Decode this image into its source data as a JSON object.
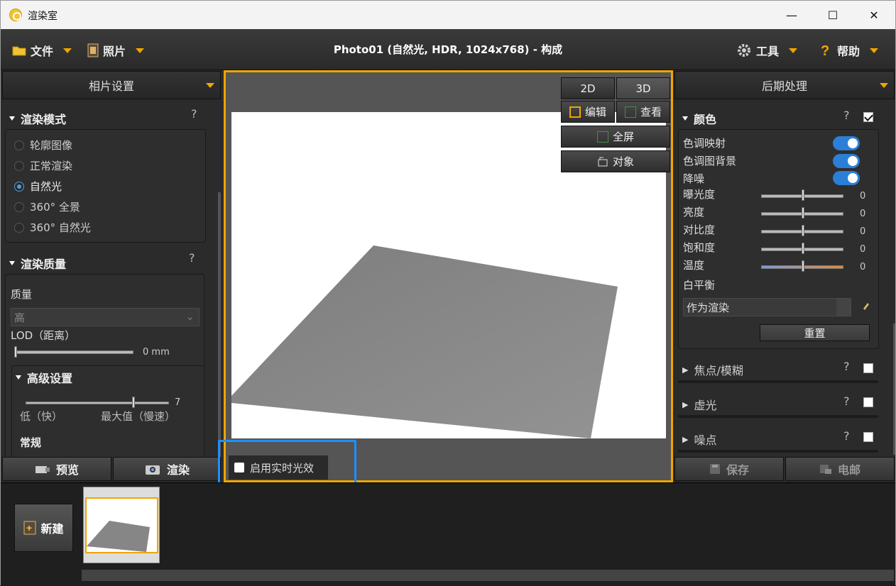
{
  "window": {
    "title": "渲染室",
    "minimize": "—",
    "maximize": "☐",
    "close": "✕"
  },
  "menubar": {
    "file": "文件",
    "photo": "照片",
    "doc_title": "Photo01 (自然光, HDR, 1024x768) - 构成",
    "tools": "工具",
    "help": "帮助"
  },
  "left_panel": {
    "header": "相片设置",
    "render_mode": {
      "title": "渲染模式",
      "help": "?",
      "options": [
        "轮廓图像",
        "正常渲染",
        "自然光",
        "360° 全景",
        "360° 自然光"
      ],
      "selected_index": 2
    },
    "render_quality": {
      "title": "渲染质量",
      "help": "?",
      "quality_label": "质量",
      "quality_value": "高",
      "lod_label": "LOD（距离）",
      "lod_value": "0 mm",
      "lod_slider": 0
    },
    "advanced": {
      "title": "高级设置",
      "slider_value": "7",
      "slider_level": 0.75,
      "low_label": "低（快）",
      "max_label": "最大值（慢速）",
      "general_label": "常规"
    },
    "preview_button": "预览",
    "render_button": "渲染"
  },
  "viewport": {
    "btn_2d": "2D",
    "btn_3d": "3D",
    "btn_edit": "编辑",
    "btn_view": "查看",
    "btn_fullscreen": "全屏",
    "btn_object": "对象",
    "realtime_label": "启用实时光效"
  },
  "right_panel": {
    "header": "后期处理",
    "color": {
      "title": "颜色",
      "help": "?",
      "enabled": true,
      "tone_mapping": "色调映射",
      "tone_bg": "色调图背景",
      "denoise": "降噪",
      "exposure": "曝光度",
      "brightness": "亮度",
      "contrast": "对比度",
      "saturation": "饱和度",
      "temperature": "温度",
      "exposure_value": "0",
      "brightness_value": "0",
      "contrast_value": "0",
      "saturation_value": "0",
      "temperature_value": "0",
      "white_balance": "白平衡",
      "white_balance_value": "作为渲染",
      "reset": "重置"
    },
    "focus": {
      "title": "焦点/模糊",
      "help": "?",
      "enabled": false
    },
    "vignette": {
      "title": "虚光",
      "help": "?",
      "enabled": false
    },
    "noise": {
      "title": "噪点",
      "help": "?",
      "enabled": false
    },
    "save_button": "保存",
    "email_button": "电邮"
  },
  "filmstrip": {
    "new_button": "新建"
  },
  "colors": {
    "accent": "#f0a500",
    "highlight": "#1e90ff",
    "toggle_on": "#2b7fd6"
  }
}
